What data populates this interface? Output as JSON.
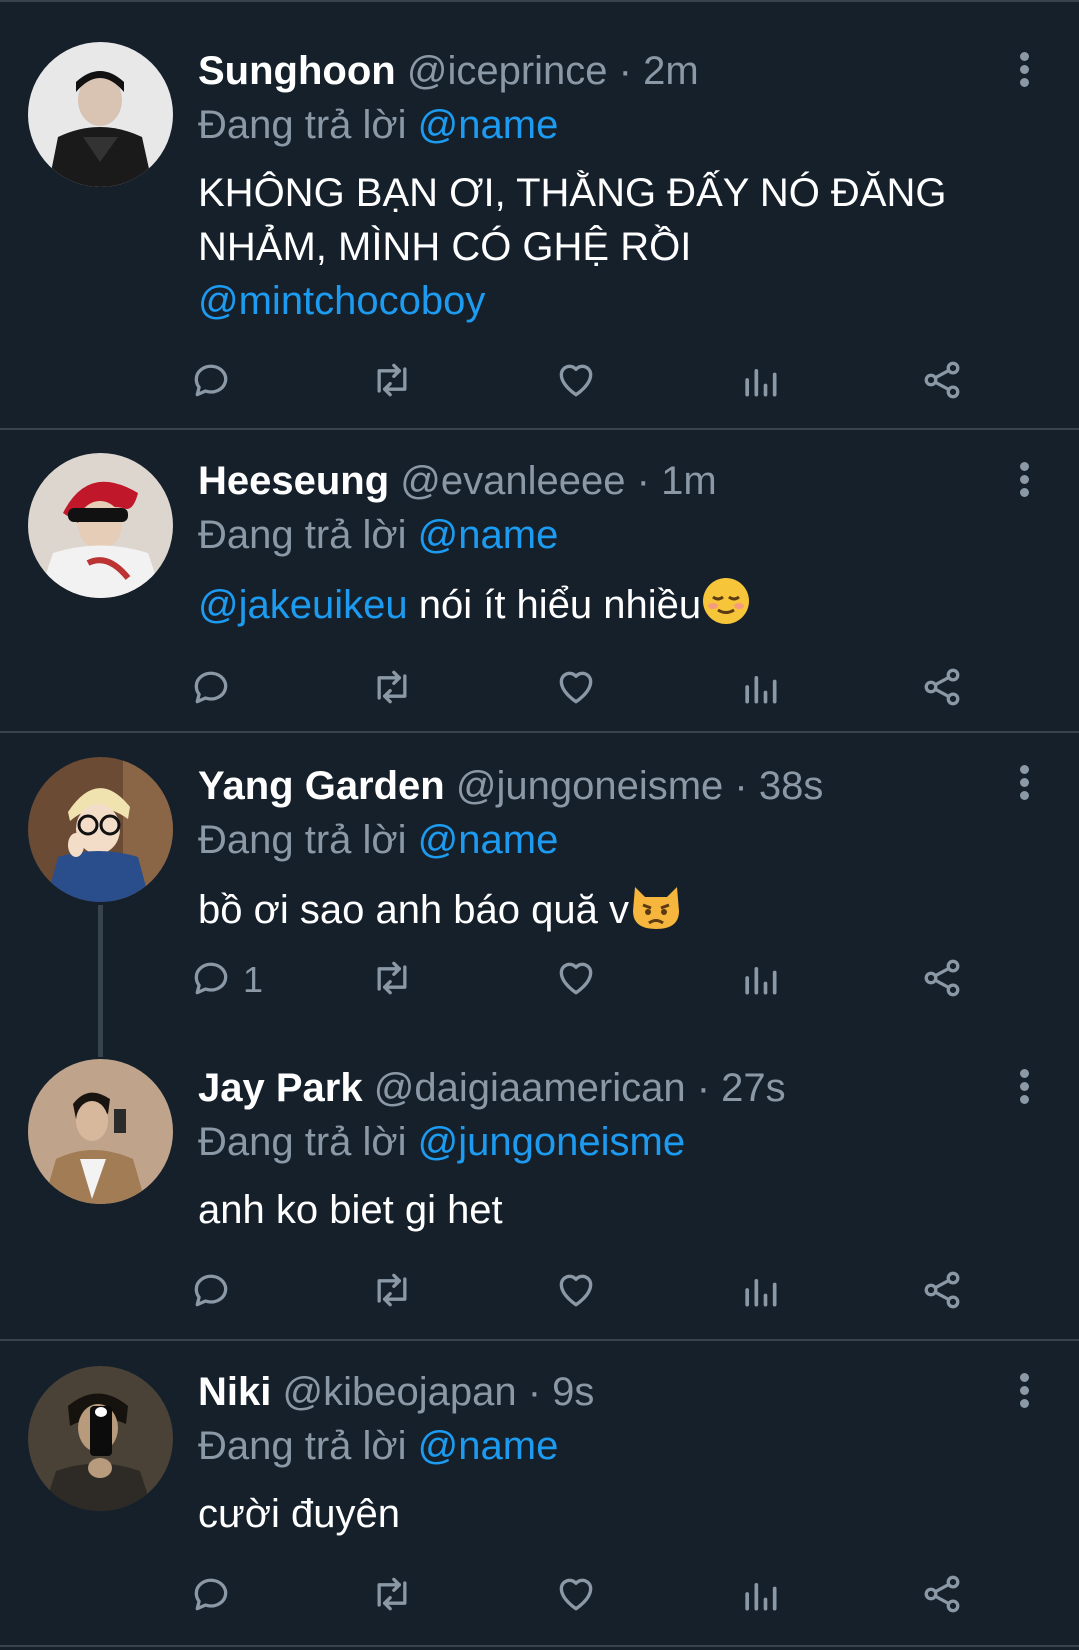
{
  "colors": {
    "background": "#15202b",
    "mention": "#1d9bf0",
    "muted": "#8b98a5",
    "divider": "#38444d"
  },
  "tweets": [
    {
      "name": "Sunghoon",
      "handle": "@iceprince",
      "dot": "·",
      "time": "2m",
      "replying_prefix": "Đang trả lời",
      "replying_to": "@name",
      "text": "KHÔNG BẠN ƠI, THẰNG ĐẤY NÓ ĐĂNG NHẢM, MÌNH CÓ GHỆ RỒI",
      "text_mention": "@mintchocoboy",
      "reply_count": ""
    },
    {
      "name": "Heeseung",
      "handle": "@evanleeee",
      "dot": "·",
      "time": "1m",
      "replying_prefix": "Đang trả lời",
      "replying_to": "@name",
      "text_mention": "@jakeuikeu",
      "text": " nói ít hiểu nhiều",
      "emoji": "relieved-face",
      "reply_count": ""
    },
    {
      "name": "Yang Garden",
      "handle": "@jungoneisme",
      "dot": "·",
      "time": "38s",
      "replying_prefix": "Đang trả lời",
      "replying_to": "@name",
      "text": "bồ ơi sao anh báo quă v",
      "emoji": "pouting-cat-face",
      "reply_count": "1"
    },
    {
      "name": "Jay Park",
      "handle": "@daigiaamerican",
      "dot": "·",
      "time": "27s",
      "replying_prefix": "Đang trả lời",
      "replying_to": "@jungoneisme",
      "text": "anh ko biet gi het",
      "reply_count": ""
    },
    {
      "name": "Niki",
      "handle": "@kibeojapan",
      "dot": "·",
      "time": "9s",
      "replying_prefix": "Đang trả lời",
      "replying_to": "@name",
      "text": "cười đuyên",
      "reply_count": ""
    }
  ]
}
